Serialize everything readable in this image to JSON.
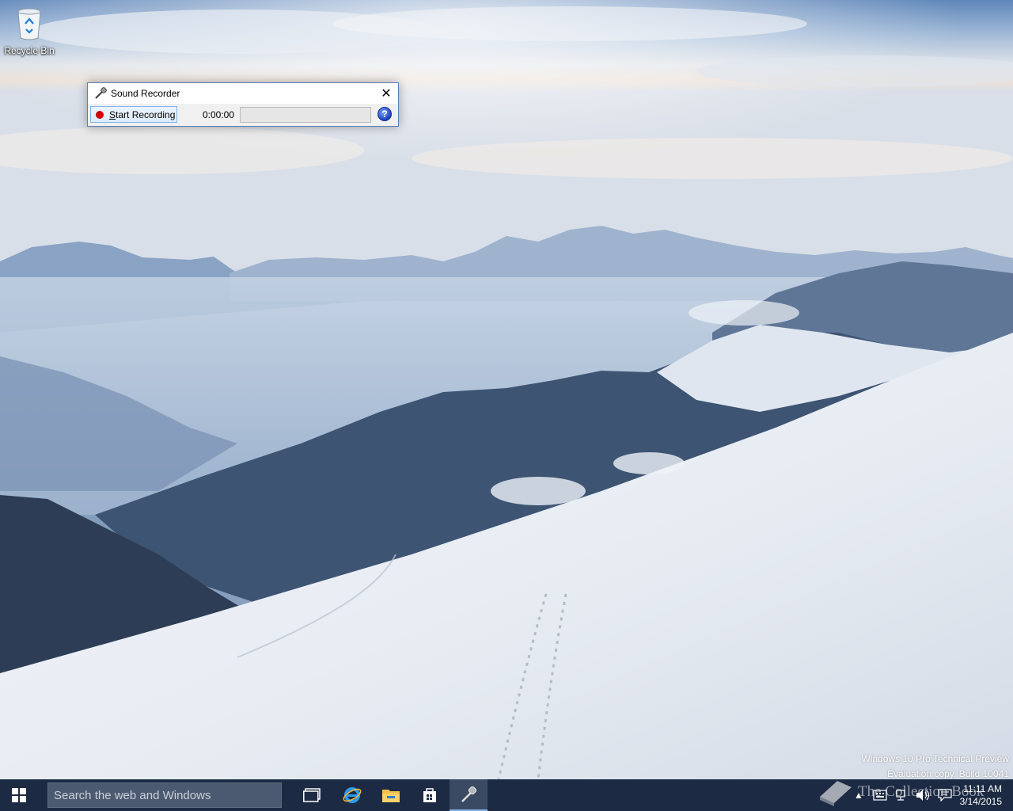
{
  "desktop": {
    "icons": [
      {
        "label": "Recycle Bin"
      }
    ],
    "watermark": {
      "line1": "Windows 10 Pro Technical Preview",
      "line2": "Evaluation copy. Build 10041"
    }
  },
  "window": {
    "title": "Sound Recorder",
    "close_symbol": "✕",
    "record_button_letter": "S",
    "record_button_rest": "tart Recording",
    "time": "0:00:00",
    "level_fraction": 0,
    "help_symbol": "?"
  },
  "taskbar": {
    "search_placeholder": "Search the web and Windows",
    "pinned": [
      {
        "name": "task-view-icon"
      },
      {
        "name": "internet-explorer-icon"
      },
      {
        "name": "file-explorer-icon"
      },
      {
        "name": "store-icon"
      },
      {
        "name": "sound-recorder-taskbar-icon",
        "active": true
      }
    ],
    "clock": {
      "time": "11:11 AM",
      "date": "3/14/2015"
    }
  },
  "branding": {
    "text": "The Collection Book"
  },
  "colors": {
    "taskbar": "#1c2a43",
    "window_border": "#5b7fb6",
    "record_dot": "#d40000",
    "help_blue": "#1a3fbf"
  }
}
